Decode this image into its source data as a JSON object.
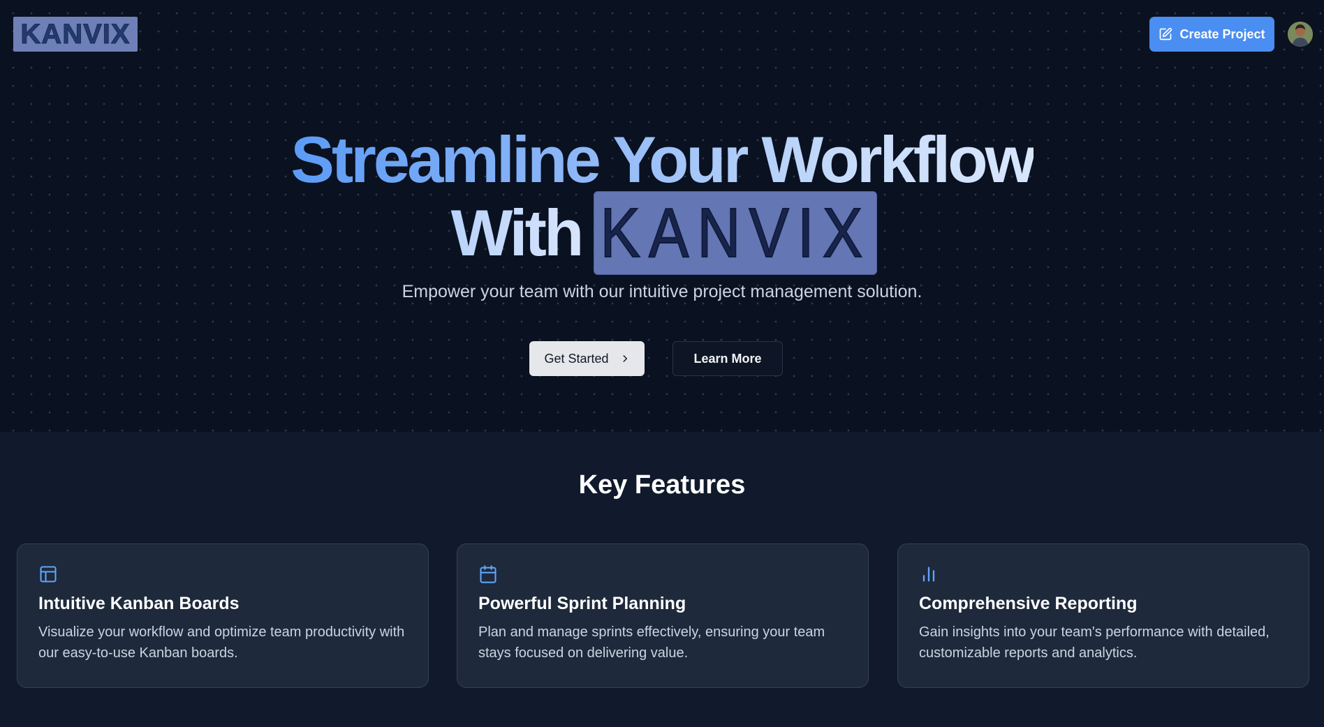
{
  "header": {
    "logo_text": "KANVIX",
    "create_label": "Create Project"
  },
  "hero": {
    "headline_line1": "Streamline Your Workflow",
    "headline_with": "With",
    "logo_text": "KANVIX",
    "subtitle": "Empower your team with our intuitive project management solution.",
    "get_started": "Get Started",
    "learn_more": "Learn More"
  },
  "features": {
    "title": "Key Features",
    "items": [
      {
        "icon": "layout-icon",
        "title": "Intuitive Kanban Boards",
        "description": "Visualize your workflow and optimize team productivity with our easy-to-use Kanban boards."
      },
      {
        "icon": "calendar-icon",
        "title": "Powerful Sprint Planning",
        "description": "Plan and manage sprints effectively, ensuring your team stays focused on delivering value."
      },
      {
        "icon": "bar-chart-icon",
        "title": "Comprehensive Reporting",
        "description": "Gain insights into your team's performance with detailed, customizable reports and analytics."
      }
    ]
  },
  "colors": {
    "background": "#0b1120",
    "accent": "#4b8ef1",
    "card": "#1e293b",
    "icon": "#60a5fa"
  }
}
